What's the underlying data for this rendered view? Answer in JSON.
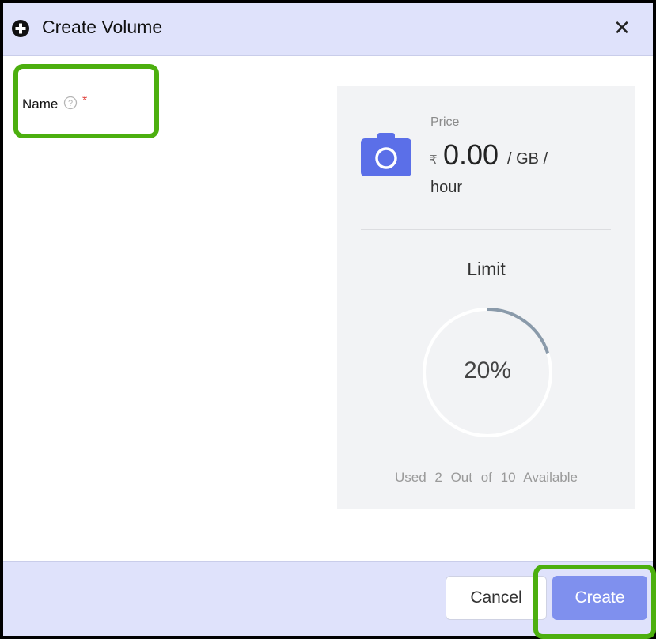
{
  "dialog": {
    "title": "Create Volume",
    "close_symbol": "✕",
    "header_icon": "plus-circle-icon"
  },
  "form": {
    "name_label": "Name",
    "required_mark": "*",
    "help_icon": "question-circle-icon",
    "name_value": ""
  },
  "price": {
    "label": "Price",
    "currency_symbol": "₹",
    "amount": "0.00",
    "unit_line1": "/ GB /",
    "unit_line2": "hour",
    "icon": "camera-icon"
  },
  "limit": {
    "title": "Limit",
    "percent_text": "20%",
    "percent_value": 20,
    "usage_text": "Used 2 Out of 10 Available"
  },
  "footer": {
    "cancel_label": "Cancel",
    "create_label": "Create"
  },
  "colors": {
    "header_bg": "#dfe2fb",
    "accent": "#5b6fe8",
    "create_button": "#7f90ee",
    "gauge_fill": "#8a9aaa",
    "highlight": "#4caf0f",
    "required": "#e0423d"
  }
}
